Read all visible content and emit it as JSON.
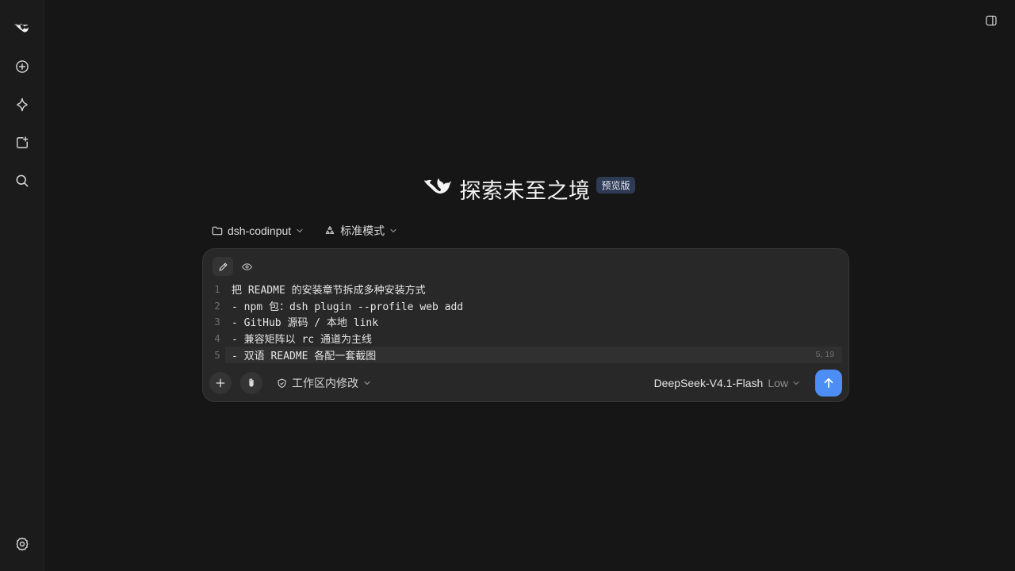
{
  "sidebar": {
    "items": [
      {
        "icon": "deepseek-whale-logo-icon"
      },
      {
        "icon": "new-chat-plus-circle-icon"
      },
      {
        "icon": "explore-sparkle-icon"
      },
      {
        "icon": "new-file-icon"
      },
      {
        "icon": "search-icon"
      },
      {
        "icon": "settings-gear-icon"
      }
    ]
  },
  "hero": {
    "title": "探索未至之境",
    "badge": "预览版"
  },
  "pre_bar": {
    "project": "dsh-codinput",
    "mode": "标准模式"
  },
  "editor": {
    "lines": [
      {
        "num": "1",
        "text": "把 README 的安装章节拆成多种安装方式"
      },
      {
        "num": "2",
        "text": "- npm 包：dsh plugin --profile web add"
      },
      {
        "num": "3",
        "text": "- GitHub 源码 / 本地 link"
      },
      {
        "num": "4",
        "text": "- 兼容矩阵以 rc 通道为主线"
      },
      {
        "num": "5",
        "text": "- 双语 README 各配一套截图"
      }
    ],
    "cursor_position": "5, 19"
  },
  "composer": {
    "scope_label": "工作区内修改",
    "model_name": "DeepSeek-V4.1-Flash",
    "model_effort": "Low"
  },
  "colors": {
    "background": "#161616",
    "composer": "#282828",
    "accent": "#4c8df6",
    "badge": "#2f3a55"
  }
}
